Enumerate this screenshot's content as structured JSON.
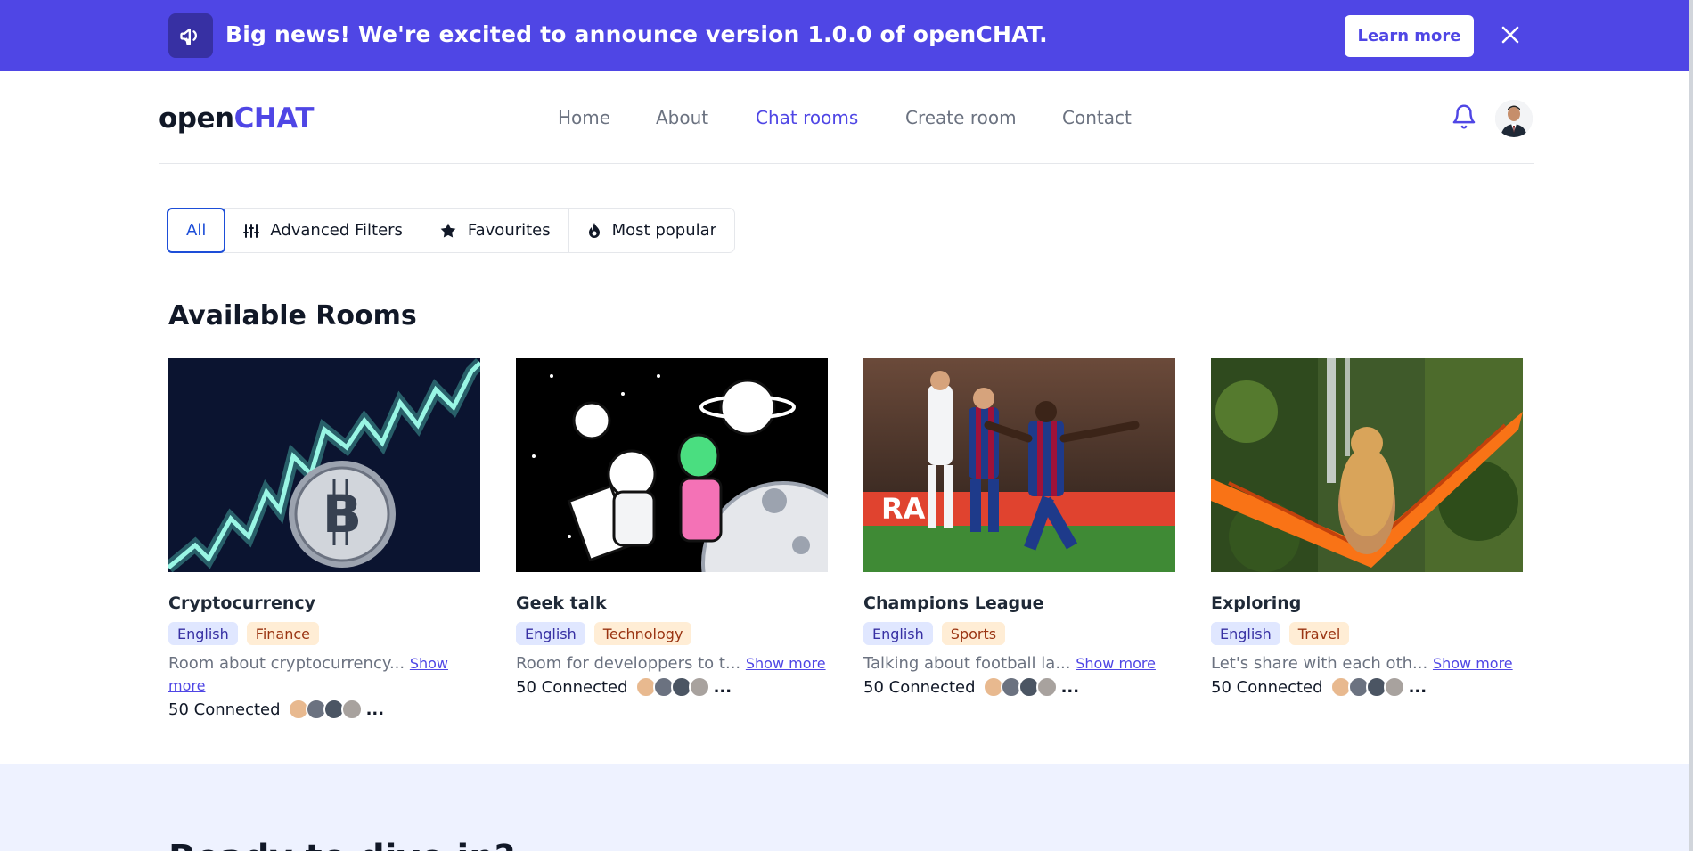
{
  "banner": {
    "text": "Big news! We're excited to announce version 1.0.0 of openCHAT.",
    "button_label": "Learn more",
    "icon": "megaphone-icon",
    "close_icon": "close-icon"
  },
  "header": {
    "logo_prefix": "open",
    "logo_suffix": "CHAT",
    "nav": [
      "Home",
      "About",
      "Chat rooms",
      "Create room",
      "Contact"
    ],
    "active_nav": "Chat rooms",
    "bell_icon": "bell-icon"
  },
  "filters": {
    "all": "All",
    "advanced": "Advanced Filters",
    "favourites": "Favourites",
    "popular": "Most popular"
  },
  "section_title": "Available Rooms",
  "rooms": [
    {
      "title": "Cryptocurrency",
      "language": "English",
      "category": "Finance",
      "description": "Room about cryptocurrency...",
      "show_more": "Show more",
      "connected": "50 Connected"
    },
    {
      "title": "Geek talk",
      "language": "English",
      "category": "Technology",
      "description": "Room for developpers to t...",
      "show_more": "Show more",
      "connected": "50 Connected"
    },
    {
      "title": "Champions League",
      "language": "English",
      "category": "Sports",
      "description": "Talking about football la...",
      "show_more": "Show more",
      "connected": "50 Connected"
    },
    {
      "title": "Exploring",
      "language": "English",
      "category": "Travel",
      "description": "Let's share with each oth...",
      "show_more": "Show more",
      "connected": "50 Connected"
    }
  ],
  "more_dots": "...",
  "bottom_title": "Ready to dive in?",
  "colors": {
    "primary": "#4f46e5",
    "banner_bg": "#4f46e5",
    "bottom_bg": "#eef2ff"
  }
}
